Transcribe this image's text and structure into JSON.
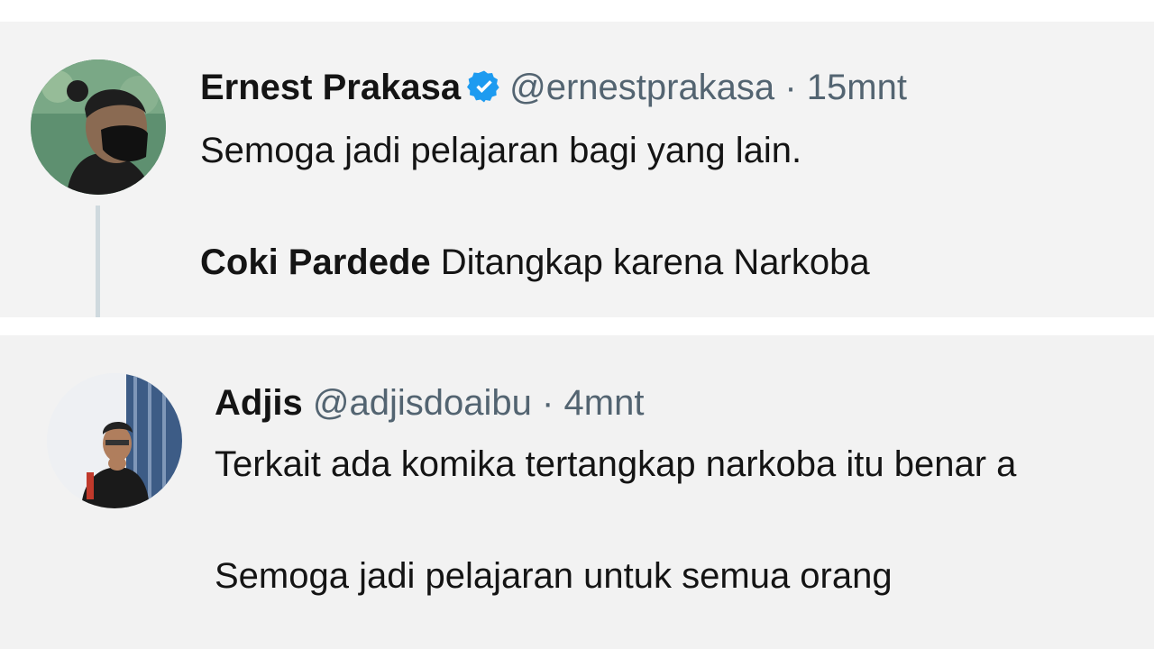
{
  "tweets": [
    {
      "name": "Ernest Prakasa",
      "verified": true,
      "handle": "@ernestprakasa",
      "separator": "·",
      "time": "15mnt",
      "text": "Semoga jadi pelajaran bagi yang lain.",
      "quote_bold": "Coki Pardede",
      "quote_rest": " Ditangkap karena Narkoba"
    },
    {
      "name": "Adjis",
      "handle": "@adjisdoaibu",
      "separator": "·",
      "time": "4mnt",
      "line1": "Terkait ada komika tertangkap narkoba itu benar a",
      "line2": "Semoga jadi pelajaran untuk semua orang"
    }
  ],
  "colors": {
    "card_bg": "#f3f3f3",
    "text": "#141414",
    "muted": "#536471",
    "verified": "#1d9bf0",
    "thread_line": "#cfd9de"
  },
  "icons": {
    "verified": "verified-badge-icon"
  }
}
